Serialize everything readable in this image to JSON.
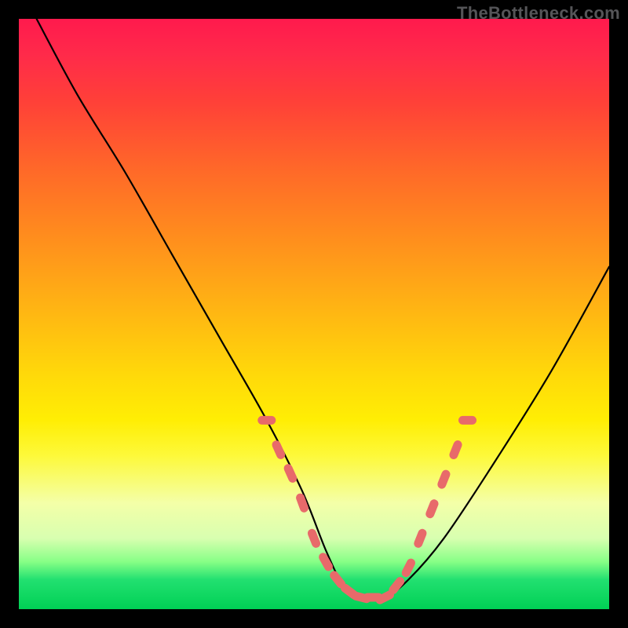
{
  "watermark": "TheBottleneck.com",
  "chart_data": {
    "type": "line",
    "title": "",
    "xlabel": "",
    "ylabel": "",
    "x_range": [
      0,
      100
    ],
    "y_range": [
      0,
      100
    ],
    "series": [
      {
        "name": "bottleneck-curve",
        "x": [
          3,
          10,
          18,
          26,
          34,
          42,
          48,
          52,
          55,
          58,
          62,
          66,
          72,
          80,
          90,
          100
        ],
        "y": [
          100,
          87,
          74,
          60,
          46,
          32,
          20,
          10,
          4,
          2,
          2,
          5,
          12,
          24,
          40,
          58
        ]
      }
    ],
    "markers": {
      "name": "highlight-dots",
      "color": "#e86a6a",
      "x": [
        42,
        44,
        46,
        48,
        50,
        52,
        54,
        56,
        58,
        60,
        62,
        64,
        66,
        68,
        70,
        72,
        74,
        76
      ],
      "y": [
        32,
        27,
        23,
        18,
        12,
        8,
        5,
        3,
        2,
        2,
        2,
        4,
        7,
        12,
        17,
        22,
        27,
        32
      ]
    }
  }
}
